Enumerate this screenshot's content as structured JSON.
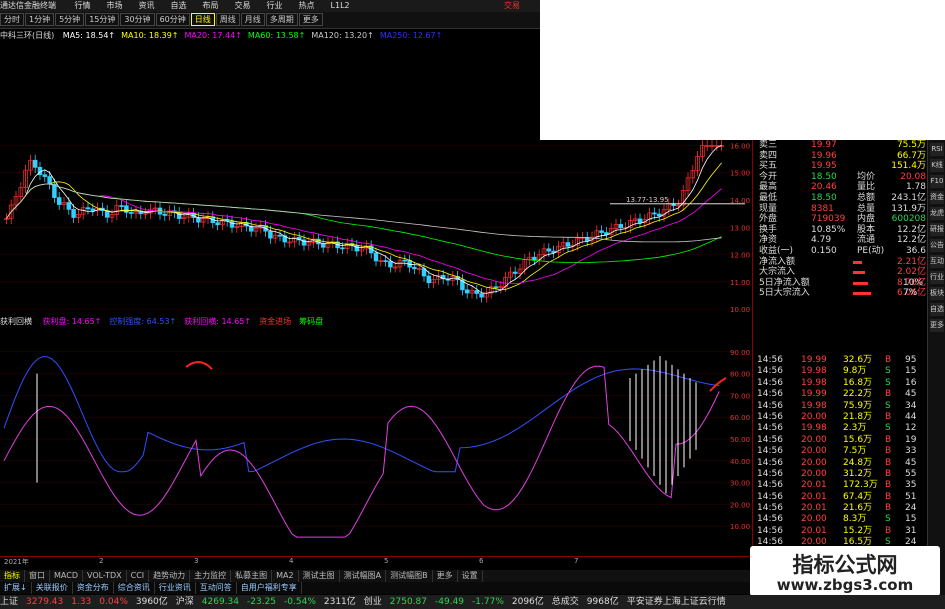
{
  "app": {
    "title": "通达信金融终端",
    "menu": [
      "行情",
      "市场",
      "资讯",
      "自选",
      "布局",
      "交易",
      "行业",
      "热点",
      "L1L2"
    ],
    "trade_label": "交易"
  },
  "periods": {
    "items": [
      "分时",
      "1分钟",
      "5分钟",
      "15分钟",
      "30分钟",
      "60分钟",
      "日线",
      "周线",
      "月线",
      "多周期",
      "更多"
    ],
    "active_index": 6
  },
  "ma_legend": {
    "stock": "中科三环(日线)",
    "items": [
      {
        "text": "MA5: 18.54↑",
        "color": "#ffffff"
      },
      {
        "text": "MA10: 18.39↑",
        "color": "#ffff00"
      },
      {
        "text": "MA20: 17.44↑",
        "color": "#ff00ff"
      },
      {
        "text": "MA60: 13.58↑",
        "color": "#00ff00"
      },
      {
        "text": "MA120: 13.20↑",
        "color": "#cccccc"
      },
      {
        "text": "MA250: 12.67↑",
        "color": "#3030ff"
      }
    ]
  },
  "price_axis": [
    "16.00",
    "15.00",
    "14.00",
    "13.00",
    "12.00",
    "11.00",
    "10.00"
  ],
  "price_box": "13.77-13.95",
  "ind_legend": {
    "name": "获利回横",
    "items": [
      {
        "text": "获利盘: 14.65↑",
        "color": "#ff00ff"
      },
      {
        "text": "控制强度: 64.53↑",
        "color": "#3050ff"
      },
      {
        "text": "获利回横: 14.65↑",
        "color": "#ff00ff"
      },
      {
        "text": "资金进场",
        "color": "#ff3030"
      },
      {
        "text": "筹码盘",
        "color": "#00ff00"
      }
    ]
  },
  "ind_axis": [
    "90.00",
    "80.00",
    "70.00",
    "60.00",
    "50.00",
    "40.00",
    "30.00",
    "20.00",
    "10.00"
  ],
  "time_axis": [
    "2021年",
    "2",
    "3",
    "4",
    "5",
    "6",
    "7"
  ],
  "quote": {
    "rows": [
      {
        "l": "卖三",
        "v1": "19.97",
        "c1": "up",
        "k2": "",
        "v2": "75.5万",
        "c2": "yl"
      },
      {
        "l": "卖四",
        "v1": "19.96",
        "c1": "up",
        "k2": "",
        "v2": "66.7万",
        "c2": "yl"
      },
      {
        "l": "买五",
        "v1": "19.95",
        "c1": "up",
        "k2": "",
        "v2": "151.4万",
        "c2": "yl"
      },
      {
        "l": "今开",
        "v1": "18.50",
        "c1": "dn",
        "k2": "均价",
        "v2": "20.08",
        "c2": "up"
      },
      {
        "l": "最高",
        "v1": "20.46",
        "c1": "up",
        "k2": "量比",
        "v2": "1.78",
        "c2": "wh"
      },
      {
        "l": "最低",
        "v1": "18.50",
        "c1": "dn",
        "k2": "总额",
        "v2": "243.1亿",
        "c2": "wh"
      },
      {
        "l": "现量",
        "v1": "8381",
        "c1": "up",
        "k2": "总量",
        "v2": "131.9万",
        "c2": "wh"
      },
      {
        "l": "外盘",
        "v1": "719039",
        "c1": "up",
        "k2": "内盘",
        "v2": "600208",
        "c2": "dn"
      },
      {
        "l": "换手",
        "v1": "10.85%",
        "c1": "wh",
        "k2": "股本",
        "v2": "12.2亿",
        "c2": "wh"
      },
      {
        "l": "净资",
        "v1": "4.79",
        "c1": "wh",
        "k2": "流通",
        "v2": "12.2亿",
        "c2": "wh"
      },
      {
        "l": "收益(一)",
        "v1": "0.150",
        "c1": "wh",
        "k2": "PE(动)",
        "v2": "36.6",
        "c2": "wh"
      },
      {
        "l": "净流入额",
        "v1": "",
        "c1": "up",
        "k2": "",
        "v2": "2.21亿",
        "c2": "up"
      },
      {
        "l": "大宗流入",
        "v1": "",
        "c1": "up",
        "k2": "",
        "v2": "2.02亿",
        "c2": "up"
      },
      {
        "l": "5日净流入额",
        "v1": "",
        "c1": "up",
        "k2": "",
        "v2": "8.76亿",
        "c2": "up"
      },
      {
        "l": "5日大宗流入",
        "v1": "",
        "c1": "up",
        "k2": "",
        "v2": "6.06亿",
        "c2": "up"
      }
    ],
    "pct": [
      "",
      "",
      "",
      "",
      "",
      "",
      "",
      "",
      "",
      "",
      "",
      "",
      "",
      "10%",
      "7%"
    ]
  },
  "trades": [
    {
      "t": "14:56",
      "p": "19.99",
      "v": "32.6万",
      "bs": "B",
      "n": "95"
    },
    {
      "t": "14:56",
      "p": "19.98",
      "v": "9.8万",
      "bs": "S",
      "n": "15"
    },
    {
      "t": "14:56",
      "p": "19.98",
      "v": "16.8万",
      "bs": "S",
      "n": "16"
    },
    {
      "t": "14:56",
      "p": "19.99",
      "v": "22.2万",
      "bs": "B",
      "n": "45"
    },
    {
      "t": "14:56",
      "p": "19.98",
      "v": "75.9万",
      "bs": "S",
      "n": "34"
    },
    {
      "t": "14:56",
      "p": "20.00",
      "v": "21.8万",
      "bs": "B",
      "n": "44"
    },
    {
      "t": "14:56",
      "p": "19.98",
      "v": "2.3万",
      "bs": "S",
      "n": "12"
    },
    {
      "t": "14:56",
      "p": "20.00",
      "v": "15.6万",
      "bs": "B",
      "n": "19"
    },
    {
      "t": "14:56",
      "p": "20.00",
      "v": "7.5万",
      "bs": "B",
      "n": "33"
    },
    {
      "t": "14:56",
      "p": "20.00",
      "v": "24.8万",
      "bs": "B",
      "n": "45"
    },
    {
      "t": "14:56",
      "p": "20.00",
      "v": "31.2万",
      "bs": "B",
      "n": "55"
    },
    {
      "t": "14:56",
      "p": "20.01",
      "v": "172.3万",
      "bs": "B",
      "n": "35"
    },
    {
      "t": "14:56",
      "p": "20.01",
      "v": "67.4万",
      "bs": "B",
      "n": "51"
    },
    {
      "t": "14:56",
      "p": "20.01",
      "v": "21.6万",
      "bs": "B",
      "n": "24"
    },
    {
      "t": "14:56",
      "p": "20.00",
      "v": "8.3万",
      "bs": "S",
      "n": "15"
    },
    {
      "t": "14:56",
      "p": "20.01",
      "v": "15.2万",
      "bs": "B",
      "n": "31"
    },
    {
      "t": "14:56",
      "p": "20.00",
      "v": "16.5万",
      "bs": "S",
      "n": "24"
    }
  ],
  "tabs": [
    "指标",
    "窗口",
    "MACD",
    "VOL-TDX",
    "CCI",
    "趋势动力",
    "主力监控",
    "私募主图",
    "MA2",
    "测试主图",
    "测试幅图A",
    "测试幅图B",
    "更多",
    "设置"
  ],
  "tabs_active": 0,
  "tabs2": [
    "扩展↓",
    "关联报价",
    "资金分布",
    "综合资讯",
    "行业资讯",
    "互动问答",
    "自用户福利专享"
  ],
  "status": [
    {
      "t": "上证",
      "c": "wh"
    },
    {
      "t": "3279.43",
      "c": "up"
    },
    {
      "t": "1.33",
      "c": "up"
    },
    {
      "t": "0.04%",
      "c": "up"
    },
    {
      "t": "3960亿",
      "c": "wh"
    },
    {
      "t": "沪深",
      "c": "wh"
    },
    {
      "t": "4269.34",
      "c": "dn"
    },
    {
      "t": "-23.25",
      "c": "dn"
    },
    {
      "t": "-0.54%",
      "c": "dn"
    },
    {
      "t": "2311亿",
      "c": "wh"
    },
    {
      "t": "创业",
      "c": "wh"
    },
    {
      "t": "2750.87",
      "c": "dn"
    },
    {
      "t": "-49.49",
      "c": "dn"
    },
    {
      "t": "-1.77%",
      "c": "dn"
    },
    {
      "t": "2096亿",
      "c": "wh"
    },
    {
      "t": "总成交",
      "c": "wh"
    },
    {
      "t": "9968亿",
      "c": "wh"
    },
    {
      "t": "平安证券上海上证云行情",
      "c": "wh"
    }
  ],
  "watermark": {
    "title": "指标公式网",
    "url": "www.zbgs3.com"
  },
  "sidebar_icons": [
    "RSI",
    "K线",
    "F10",
    "资金",
    "龙虎",
    "研报",
    "公告",
    "互动",
    "行业",
    "板块",
    "自选",
    "更多"
  ]
}
